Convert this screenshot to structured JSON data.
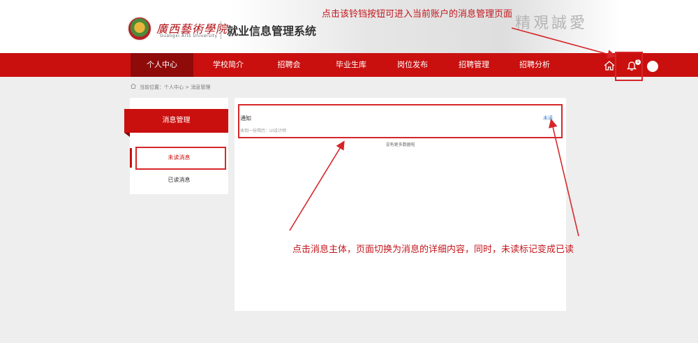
{
  "header": {
    "logo_cn": "廣西藝術學院",
    "logo_en": "Guangxi Arts University",
    "system_title": "就业信息管理系统",
    "calligraphy": "精覌誠愛"
  },
  "nav": {
    "items": [
      {
        "label": "个人中心",
        "active": true
      },
      {
        "label": "学校简介",
        "active": false
      },
      {
        "label": "招聘会",
        "active": false
      },
      {
        "label": "毕业生库",
        "active": false
      },
      {
        "label": "岗位发布",
        "active": false
      },
      {
        "label": "招聘管理",
        "active": false
      },
      {
        "label": "招聘分析",
        "active": false
      }
    ],
    "bell_badge": "1",
    "icons": [
      "home-icon",
      "bell-icon",
      "avatar"
    ]
  },
  "breadcrumb": {
    "icon": "home-icon",
    "text": "当前位置：个人中心 > 消息管理"
  },
  "sidebar": {
    "title": "消息管理",
    "items": [
      {
        "label": "未读消息",
        "selected": true
      },
      {
        "label": "已读消息",
        "selected": false
      }
    ]
  },
  "messages": [
    {
      "title": "通知",
      "body": "收到一份简历：UI设计师",
      "status": "未读"
    }
  ],
  "list_footer": "没有更多数据啦",
  "annotations": {
    "top": "点击该铃铛按钮可进入当前账户的消息管理页面",
    "bottom": "点击消息主体，页面切换为消息的详细内容，同时，未读标记变成已读"
  },
  "colors": {
    "brand_red": "#c9100f",
    "nav_active": "#8f0b0a",
    "annotation_red": "#c4161c",
    "link_blue": "#3b82d1"
  }
}
